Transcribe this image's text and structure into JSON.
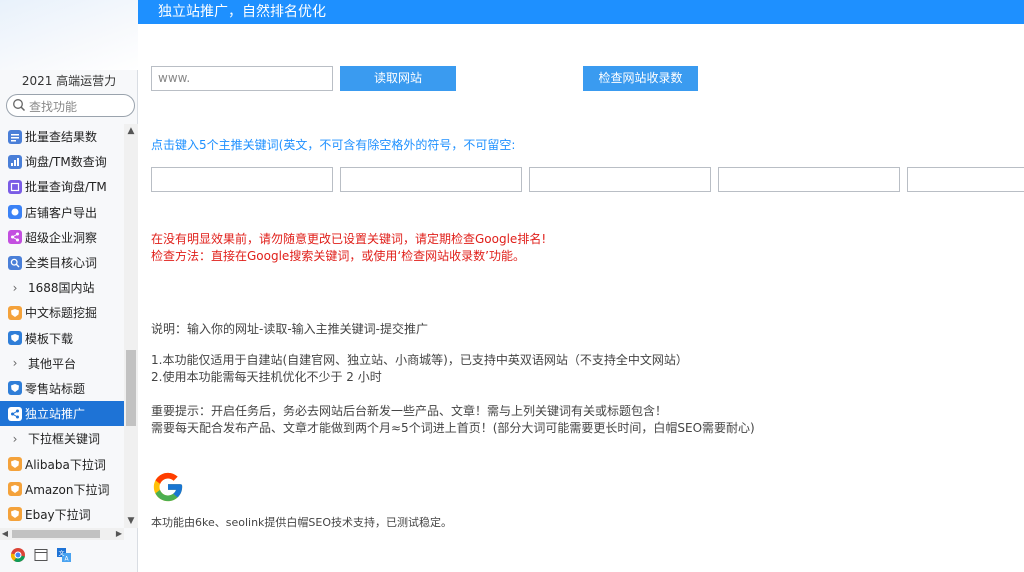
{
  "sidebar": {
    "brand": "2021 高端运营力",
    "search_placeholder": "查找功能",
    "items": [
      {
        "label": "批量查结果数",
        "icon": "search-list-icon",
        "color": "#4a7fd8",
        "type": "item"
      },
      {
        "label": "询盘/TM数查询",
        "icon": "chart-icon",
        "color": "#4a7fd8",
        "type": "item"
      },
      {
        "label": "批量查询盘/TM",
        "icon": "list-icon",
        "color": "#7a5ce6",
        "type": "item"
      },
      {
        "label": "店铺客户导出",
        "icon": "circle-icon",
        "color": "#3b82f6",
        "type": "item"
      },
      {
        "label": "超级企业洞察",
        "icon": "share-icon",
        "color": "#c34fe0",
        "type": "item"
      },
      {
        "label": "全类目核心词",
        "icon": "search-icon",
        "color": "#4a7fd8",
        "type": "item"
      },
      {
        "label": "1688国内站",
        "icon": "chevron-right-icon",
        "color": "",
        "type": "group"
      },
      {
        "label": "中文标题挖掘",
        "icon": "shield-icon",
        "color": "#f4a23b",
        "type": "item"
      },
      {
        "label": "模板下载",
        "icon": "shield-icon",
        "color": "#2f7ed8",
        "type": "item"
      },
      {
        "label": "其他平台",
        "icon": "chevron-right-icon",
        "color": "",
        "type": "group"
      },
      {
        "label": "零售站标题",
        "icon": "shield-icon",
        "color": "#2f7ed8",
        "type": "item"
      },
      {
        "label": "独立站推广",
        "icon": "share-icon",
        "color": "#1e73d6",
        "type": "active"
      },
      {
        "label": "下拉框关键词",
        "icon": "chevron-right-icon",
        "color": "",
        "type": "group"
      },
      {
        "label": "Alibaba下拉词",
        "icon": "shield-icon",
        "color": "#f4a23b",
        "type": "item"
      },
      {
        "label": "Amazon下拉词",
        "icon": "shield-icon",
        "color": "#f4a23b",
        "type": "item"
      },
      {
        "label": "Ebay下拉词",
        "icon": "shield-icon",
        "color": "#f4a23b",
        "type": "item"
      }
    ],
    "tray_icons": [
      "chrome-icon",
      "window-icon",
      "translate-icon"
    ]
  },
  "header": {
    "title": "独立站推广，自然排名优化"
  },
  "main": {
    "url_placeholder": "www.",
    "read_button": "读取网站",
    "check_button": "检查网站收录数",
    "keyword_prompt": "点击键入5个主推关键词(英文，不可含有除空格外的符号，不可留空:",
    "keyword_inputs": [
      "",
      "",
      "",
      "",
      ""
    ],
    "warning_line1": "在没有明显效果前，请勿随意更改已设置关键词，请定期检查Google排名!",
    "warning_line2": "检查方法：直接在Google搜索关键词，或使用‘检查网站收录数’功能。",
    "instructions": "说明：输入你的网址-读取-输入主推关键词-提交推广",
    "note1": "1.本功能仅适用于自建站(自建官网、独立站、小商城等)，已支持中英双语网站（不支持全中文网站）",
    "note2": "2.使用本功能需每天挂机优化不少于 2 小时",
    "important1": "重要提示：开启任务后，务必去网站后台新发一些产品、文章！需与上列关键词有关或标题包含！",
    "important2": "需要每天配合发布产品、文章才能做到两个月≈5个词进上首页！(部分大词可能需要更长时间，白帽SEO需要耐心)",
    "footer_note": "本功能由6ke、seolink提供白帽SEO技术支持，已测试稳定。"
  },
  "colors": {
    "header_bg": "#1e90ff",
    "button_bg": "#3a9bf0",
    "prompt_text": "#1e90ff",
    "warning_text": "#e0201b",
    "active_item": "#1e73d6"
  }
}
